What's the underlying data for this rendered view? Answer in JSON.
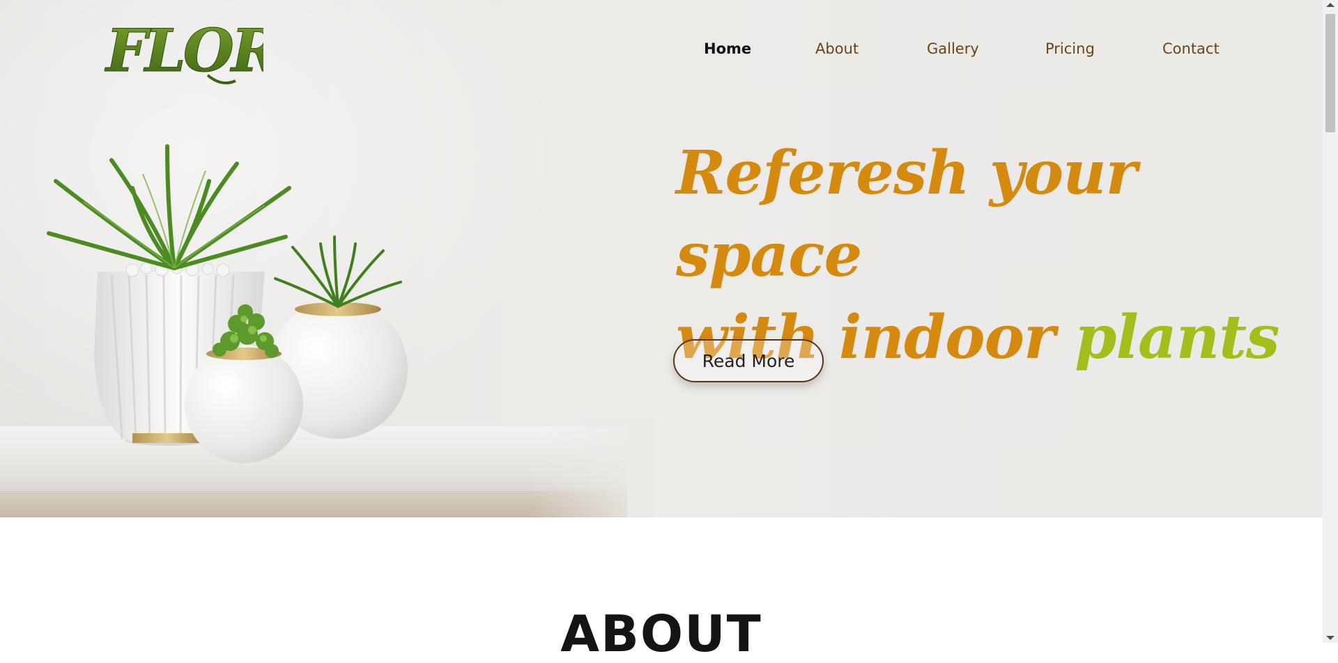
{
  "brand": {
    "logo_text": "FLORA"
  },
  "nav": {
    "items": [
      {
        "label": "Home",
        "active": true
      },
      {
        "label": "About",
        "active": false
      },
      {
        "label": "Gallery",
        "active": false
      },
      {
        "label": "Pricing",
        "active": false
      },
      {
        "label": "Contact",
        "active": false
      }
    ]
  },
  "hero": {
    "headline_line1": "Referesh your space",
    "headline_line2_main": "with indoor ",
    "headline_line2_accent": "plants",
    "cta_label": "Read More"
  },
  "about": {
    "title": "ABOUT"
  },
  "colors": {
    "headline": "#d4890f",
    "headline_accent": "#a3bd1a",
    "nav_text": "#6a4419",
    "nav_active": "#111111",
    "logo_green": "#4e7a1a"
  },
  "icons": {
    "hero_image": "potted-plants-illustration",
    "scroll_up": "scroll-up-arrow-icon",
    "scroll_down": "scroll-down-arrow-icon"
  }
}
